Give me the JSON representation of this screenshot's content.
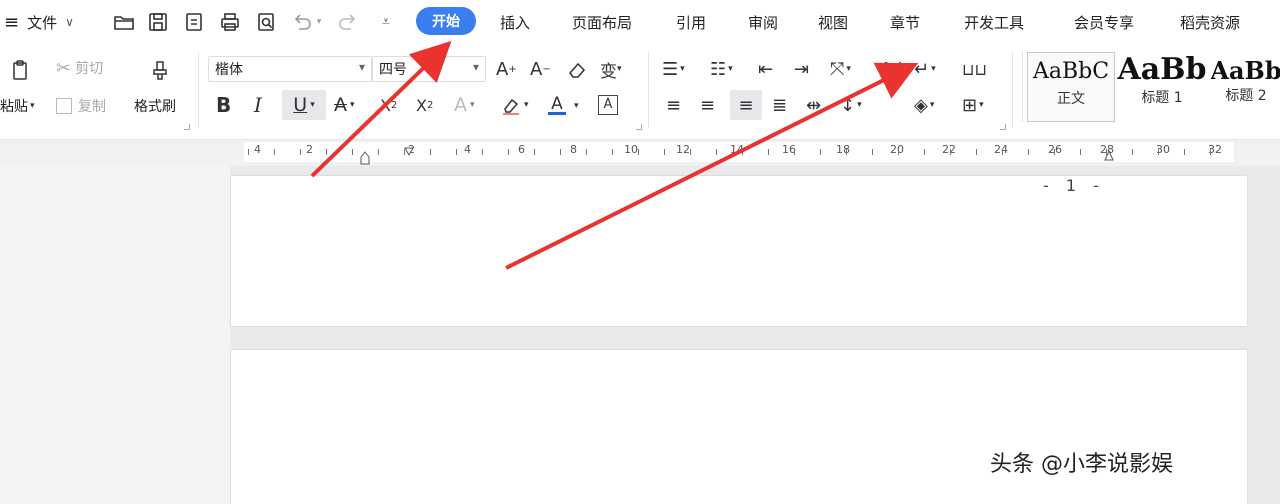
{
  "menu": {
    "hamburger_icon": "menu-icon",
    "file_label": "文件"
  },
  "tabs": [
    {
      "label": "开始",
      "active": true
    },
    {
      "label": "插入"
    },
    {
      "label": "页面布局"
    },
    {
      "label": "引用"
    },
    {
      "label": "审阅"
    },
    {
      "label": "视图"
    },
    {
      "label": "章节"
    },
    {
      "label": "开发工具"
    },
    {
      "label": "会员专享"
    },
    {
      "label": "稻壳资源"
    }
  ],
  "ribbon": {
    "paste_label": "粘贴",
    "cut_label": "剪切",
    "copy_label": "复制",
    "format_painter_label": "格式刷",
    "font_name": "楷体",
    "font_size": "四号",
    "styles": [
      {
        "sample": "AaBbC",
        "name": "正文"
      },
      {
        "sample": "AaBb",
        "name": "标题 1"
      },
      {
        "sample": "AaBb",
        "name": "标题 2"
      }
    ]
  },
  "ruler": {
    "labels": [
      "4",
      "2",
      "2",
      "4",
      "6",
      "8",
      "10",
      "12",
      "14",
      "16",
      "18",
      "20",
      "22",
      "24",
      "26",
      "28",
      "30",
      "32"
    ]
  },
  "document": {
    "page_number": "- 1 -"
  },
  "watermark": "头条 @小李说影娱",
  "colors": {
    "accent": "#3a7ef0",
    "arrow": "#e8332f",
    "font_color_bar": "#1f5fe0"
  }
}
